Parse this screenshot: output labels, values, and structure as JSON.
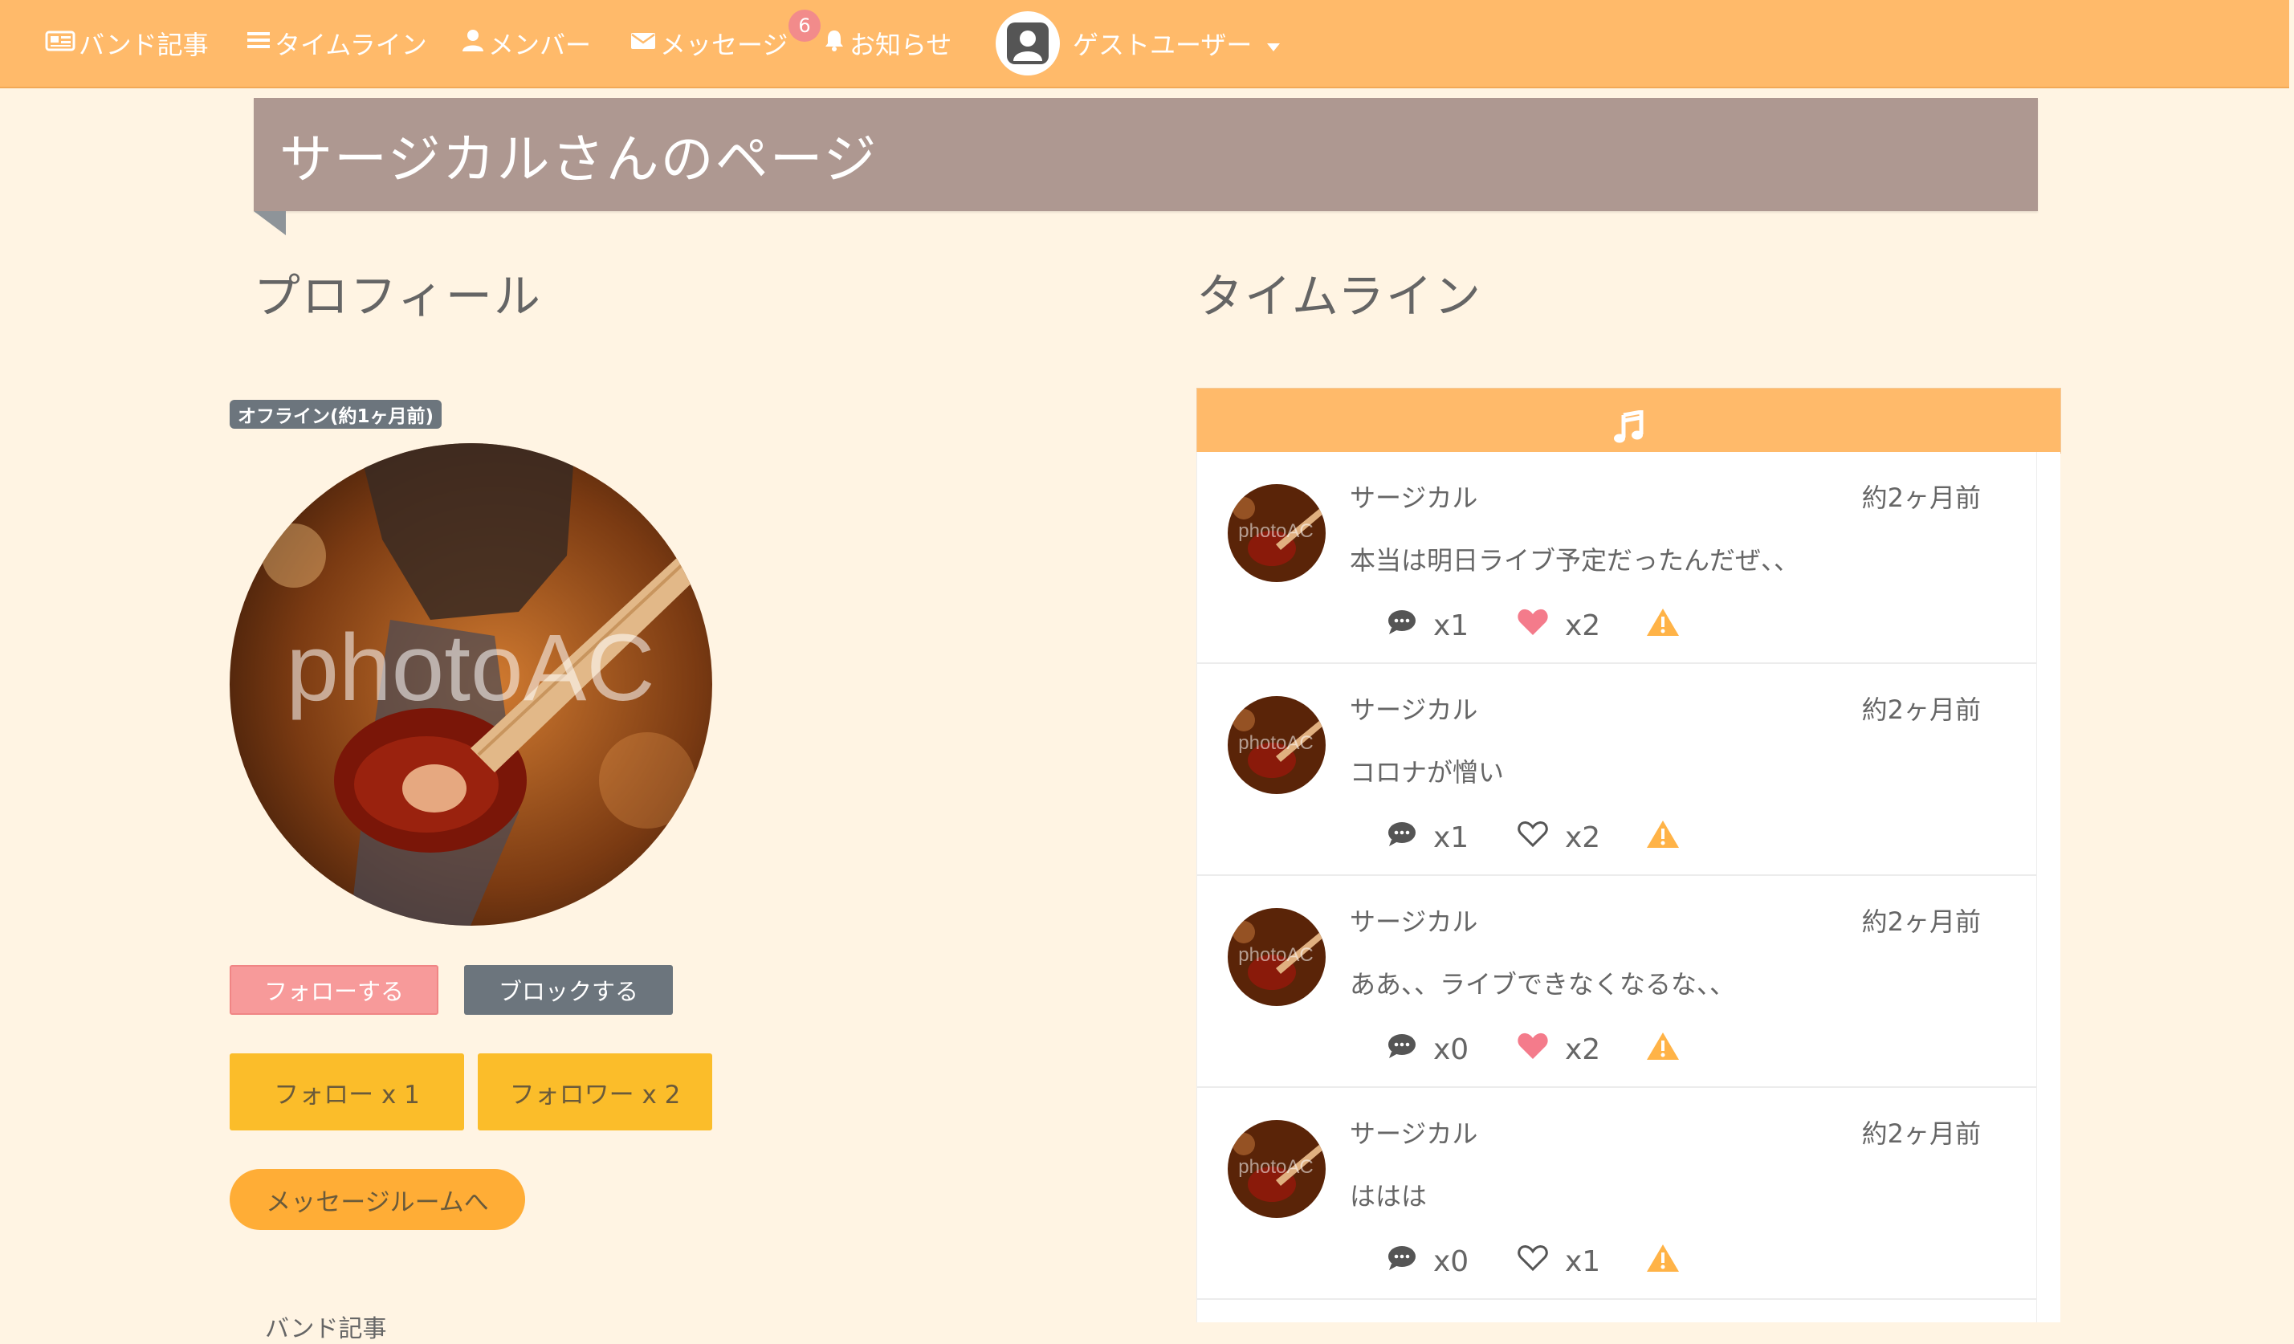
{
  "nav": {
    "items": [
      {
        "label": "バンド記事",
        "icon": "newspaper-icon"
      },
      {
        "label": "タイムライン",
        "icon": "list-icon"
      },
      {
        "label": "メンバー",
        "icon": "user-icon"
      },
      {
        "label": "メッセージ",
        "icon": "envelope-icon",
        "badge": "6"
      },
      {
        "label": "お知らせ",
        "icon": "bell-icon"
      }
    ],
    "user_label": "ゲストユーザー",
    "accent": "#ffba6a",
    "badge_color": "#f28b8b"
  },
  "page": {
    "title": "サージカルさんのページ",
    "title_bg": "#ae9891",
    "bg": "#fff4e3"
  },
  "profile": {
    "heading": "プロフィール",
    "status": "オフライン(約1ヶ月前)",
    "photo_watermark": "photoAC",
    "follow_button": "フォローする",
    "block_button": "ブロックする",
    "following_button": "フォロー x 1",
    "followers_button": "フォロワー x 2",
    "message_room_button": "メッセージルームへ",
    "below_text": "バンド記事"
  },
  "timeline": {
    "heading": "タイムライン",
    "header_icon": "music-note-icon",
    "posts": [
      {
        "author": "サージカル",
        "time": "約2ヶ月前",
        "text": "本当は明日ライブ予定だったんだぜ、、",
        "comments": "x1",
        "likes": "x2",
        "liked": true
      },
      {
        "author": "サージカル",
        "time": "約2ヶ月前",
        "text": "コロナが憎い",
        "comments": "x1",
        "likes": "x2",
        "liked": false
      },
      {
        "author": "サージカル",
        "time": "約2ヶ月前",
        "text": "ああ、、ライブできなくなるな、、",
        "comments": "x0",
        "likes": "x2",
        "liked": true
      },
      {
        "author": "サージカル",
        "time": "約2ヶ月前",
        "text": "ははは",
        "comments": "x0",
        "likes": "x1",
        "liked": false
      }
    ]
  }
}
